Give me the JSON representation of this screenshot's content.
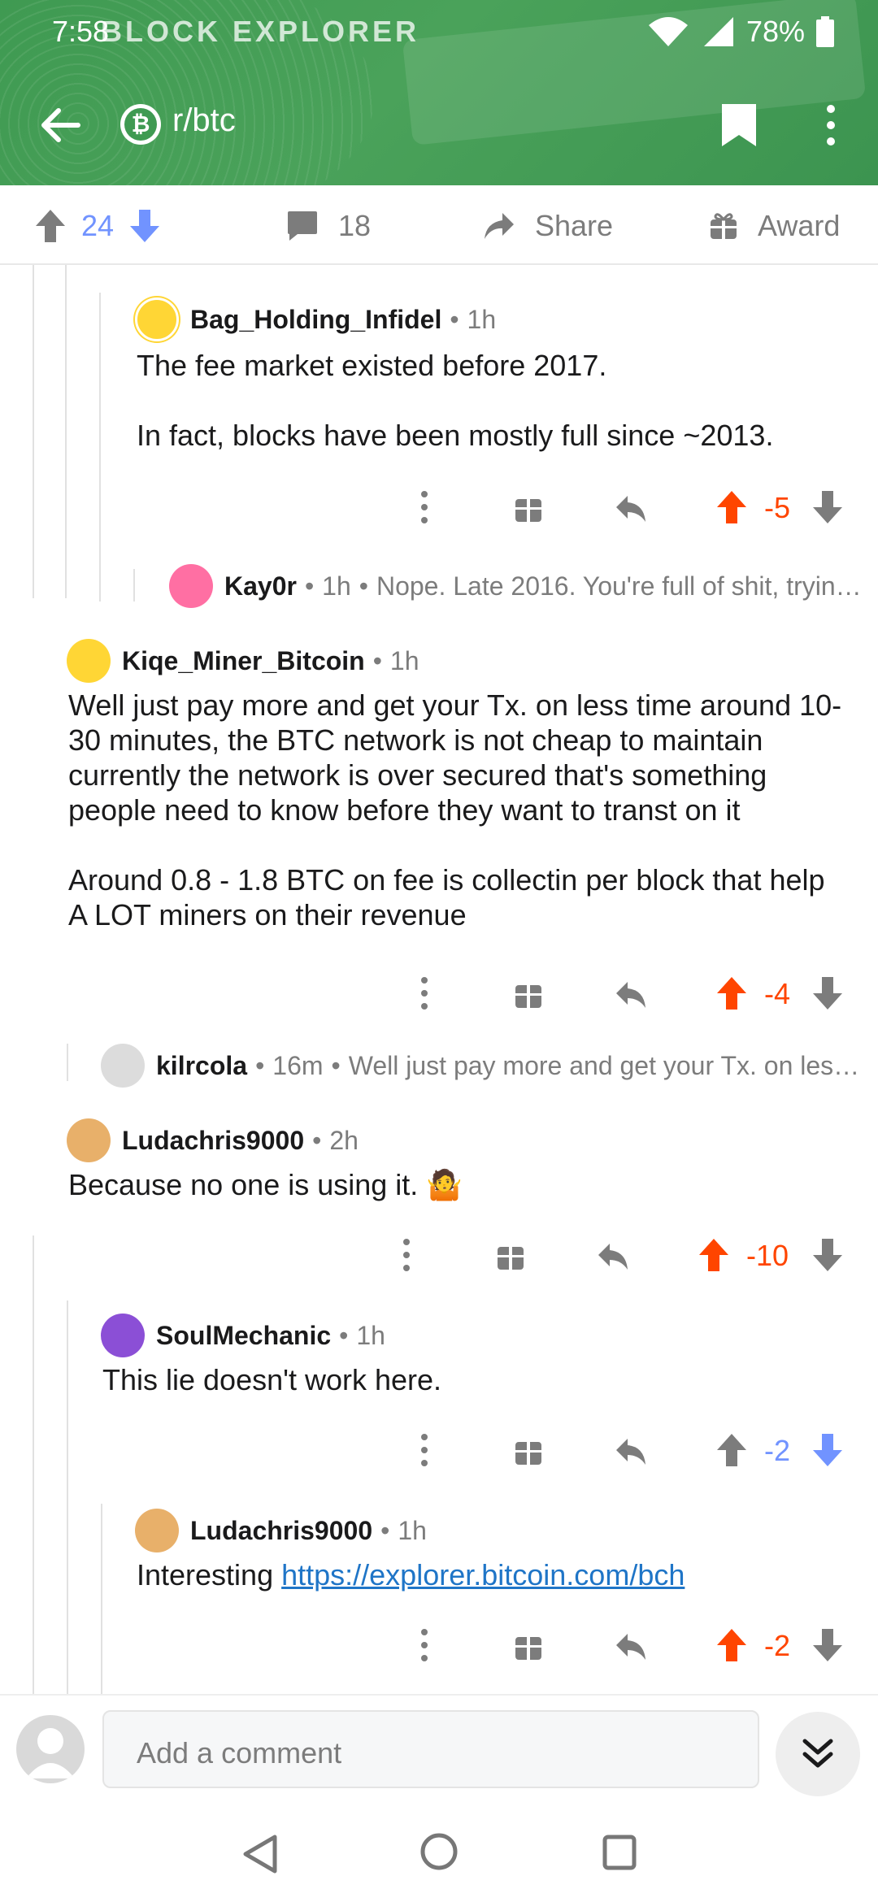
{
  "status_bar": {
    "time": "7:58",
    "battery": "78%",
    "brand_overlay": "BLOCK EXPLORER"
  },
  "header": {
    "subreddit": "r/btc",
    "subreddit_icon": "bitcoin-icon",
    "accent_color": "#46a056"
  },
  "post_actions": {
    "score": "24",
    "comments": "18",
    "share_label": "Share",
    "award_label": "Award"
  },
  "comments": [
    {
      "author": "Bag_Holding_Infidel",
      "age": "1h",
      "paragraphs": [
        "The fee market existed before 2017.",
        "In fact, blocks have been mostly full since ~2013."
      ],
      "score": "-5",
      "vote_state": "upvoted"
    },
    {
      "author": "Kay0r",
      "age": "1h",
      "preview": "Nope. Late 2016. You're full of shit, tryin…",
      "collapsed": true
    },
    {
      "author": "Kiqe_Miner_Bitcoin",
      "age": "1h",
      "paragraphs": [
        "Well just pay more and get your Tx. on less time around 10-30 minutes, the BTC network is not cheap to maintain currently the network is over secured that's something people need to know before they want to transt on it",
        "Around 0.8 - 1.8 BTC on fee is collectin per block that help A LOT miners on their revenue"
      ],
      "score": "-4",
      "vote_state": "upvoted"
    },
    {
      "author": "kilrcola",
      "age": "16m",
      "preview": "Well just pay more and get your Tx. on les…",
      "collapsed": true
    },
    {
      "author": "Ludachris9000",
      "age": "2h",
      "paragraphs": [
        "Because no one is using it. 🤷"
      ],
      "score": "-10",
      "vote_state": "upvoted"
    },
    {
      "author": "SoulMechanic",
      "age": "1h",
      "paragraphs": [
        "This lie doesn't work here."
      ],
      "score": "-2",
      "vote_state": "downvoted"
    },
    {
      "author": "Ludachris9000",
      "age": "1h",
      "text_prefix": "Interesting ",
      "link": "https://explorer.bitcoin.com/bch",
      "score": "-2",
      "vote_state": "upvoted"
    }
  ],
  "composer": {
    "placeholder": "Add a comment"
  },
  "colors": {
    "upvote": "#ff4500",
    "downvote": "#7193ff",
    "muted": "#7c7c7c"
  }
}
